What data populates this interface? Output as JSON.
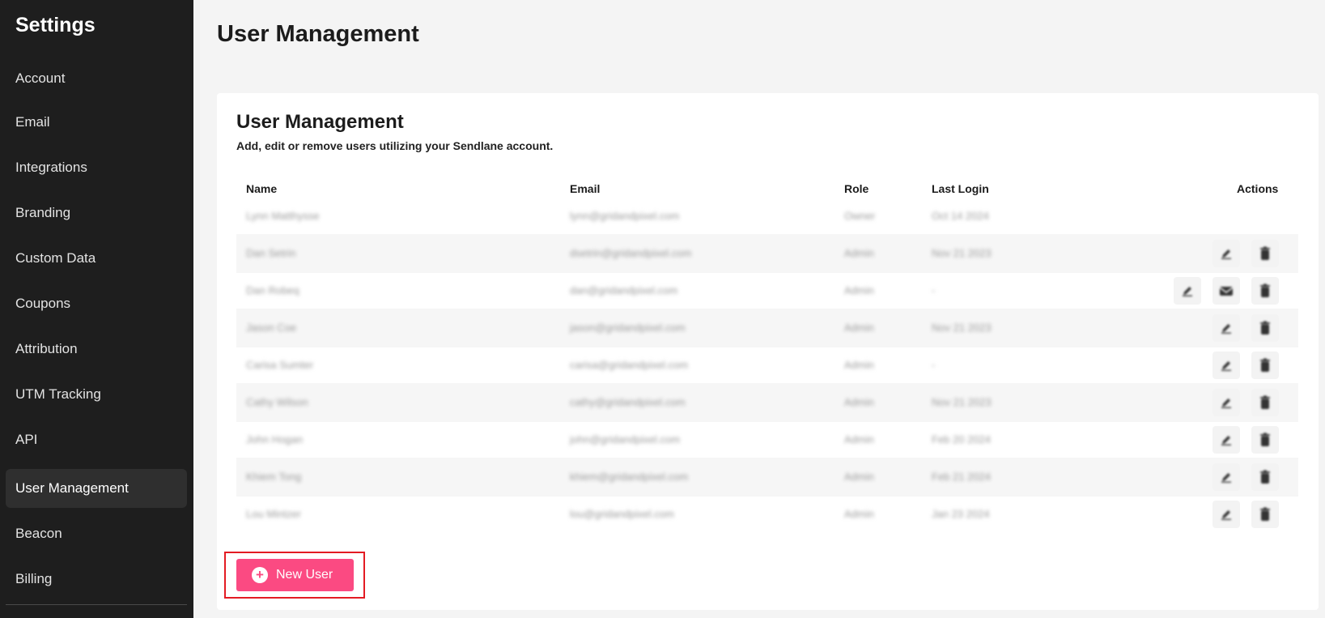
{
  "sidebar": {
    "title": "Settings",
    "items": [
      {
        "label": "Account"
      },
      {
        "label": "Email"
      },
      {
        "label": "Integrations"
      },
      {
        "label": "Branding"
      },
      {
        "label": "Custom Data"
      },
      {
        "label": "Coupons"
      },
      {
        "label": "Attribution"
      },
      {
        "label": "UTM Tracking"
      },
      {
        "label": "API"
      },
      {
        "label": "User Management",
        "active": true
      },
      {
        "label": "Beacon"
      },
      {
        "label": "Billing"
      }
    ]
  },
  "page": {
    "title": "User Management"
  },
  "card": {
    "title": "User Management",
    "subtitle": "Add, edit or remove users utilizing your Sendlane account."
  },
  "table": {
    "headers": {
      "name": "Name",
      "email": "Email",
      "role": "Role",
      "last_login": "Last Login",
      "actions": "Actions"
    },
    "rows": [
      {
        "name": "Lynn Matthysse",
        "email": "lynn@gridandpixel.com",
        "role": "Owner",
        "last_login": "Oct 14 2024",
        "actions": []
      },
      {
        "name": "Dan Setrin",
        "email": "dsetrin@gridandpixel.com",
        "role": "Admin",
        "last_login": "Nov 21 2023",
        "actions": [
          "edit-icon",
          "trash-icon"
        ]
      },
      {
        "name": "Dan Robeq",
        "email": "dan@gridandpixel.com",
        "role": "Admin",
        "last_login": "-",
        "actions": [
          "edit-icon",
          "envelope-icon",
          "trash-icon"
        ]
      },
      {
        "name": "Jason Coe",
        "email": "jason@gridandpixel.com",
        "role": "Admin",
        "last_login": "Nov 21 2023",
        "actions": [
          "edit-icon",
          "trash-icon"
        ]
      },
      {
        "name": "Carisa Sumter",
        "email": "carisa@gridandpixel.com",
        "role": "Admin",
        "last_login": "-",
        "actions": [
          "edit-icon",
          "trash-icon"
        ]
      },
      {
        "name": "Cathy Wilson",
        "email": "cathy@gridandpixel.com",
        "role": "Admin",
        "last_login": "Nov 21 2023",
        "actions": [
          "edit-icon",
          "trash-icon"
        ]
      },
      {
        "name": "John Hogan",
        "email": "john@gridandpixel.com",
        "role": "Admin",
        "last_login": "Feb 20 2024",
        "actions": [
          "edit-icon",
          "trash-icon"
        ]
      },
      {
        "name": "Khiem Tong",
        "email": "khiem@gridandpixel.com",
        "role": "Admin",
        "last_login": "Feb 21 2024",
        "actions": [
          "edit-icon",
          "trash-icon"
        ]
      },
      {
        "name": "Lou Mintzer",
        "email": "lou@gridandpixel.com",
        "role": "Admin",
        "last_login": "Jan 23 2024",
        "actions": [
          "edit-icon",
          "trash-icon"
        ]
      }
    ]
  },
  "new_user_button": {
    "label": "New User",
    "icon": "plus-circle-icon"
  },
  "colors": {
    "sidebar_bg": "#1e1e1e",
    "accent": "#fb4a82",
    "highlight_outline": "#e31b23"
  }
}
